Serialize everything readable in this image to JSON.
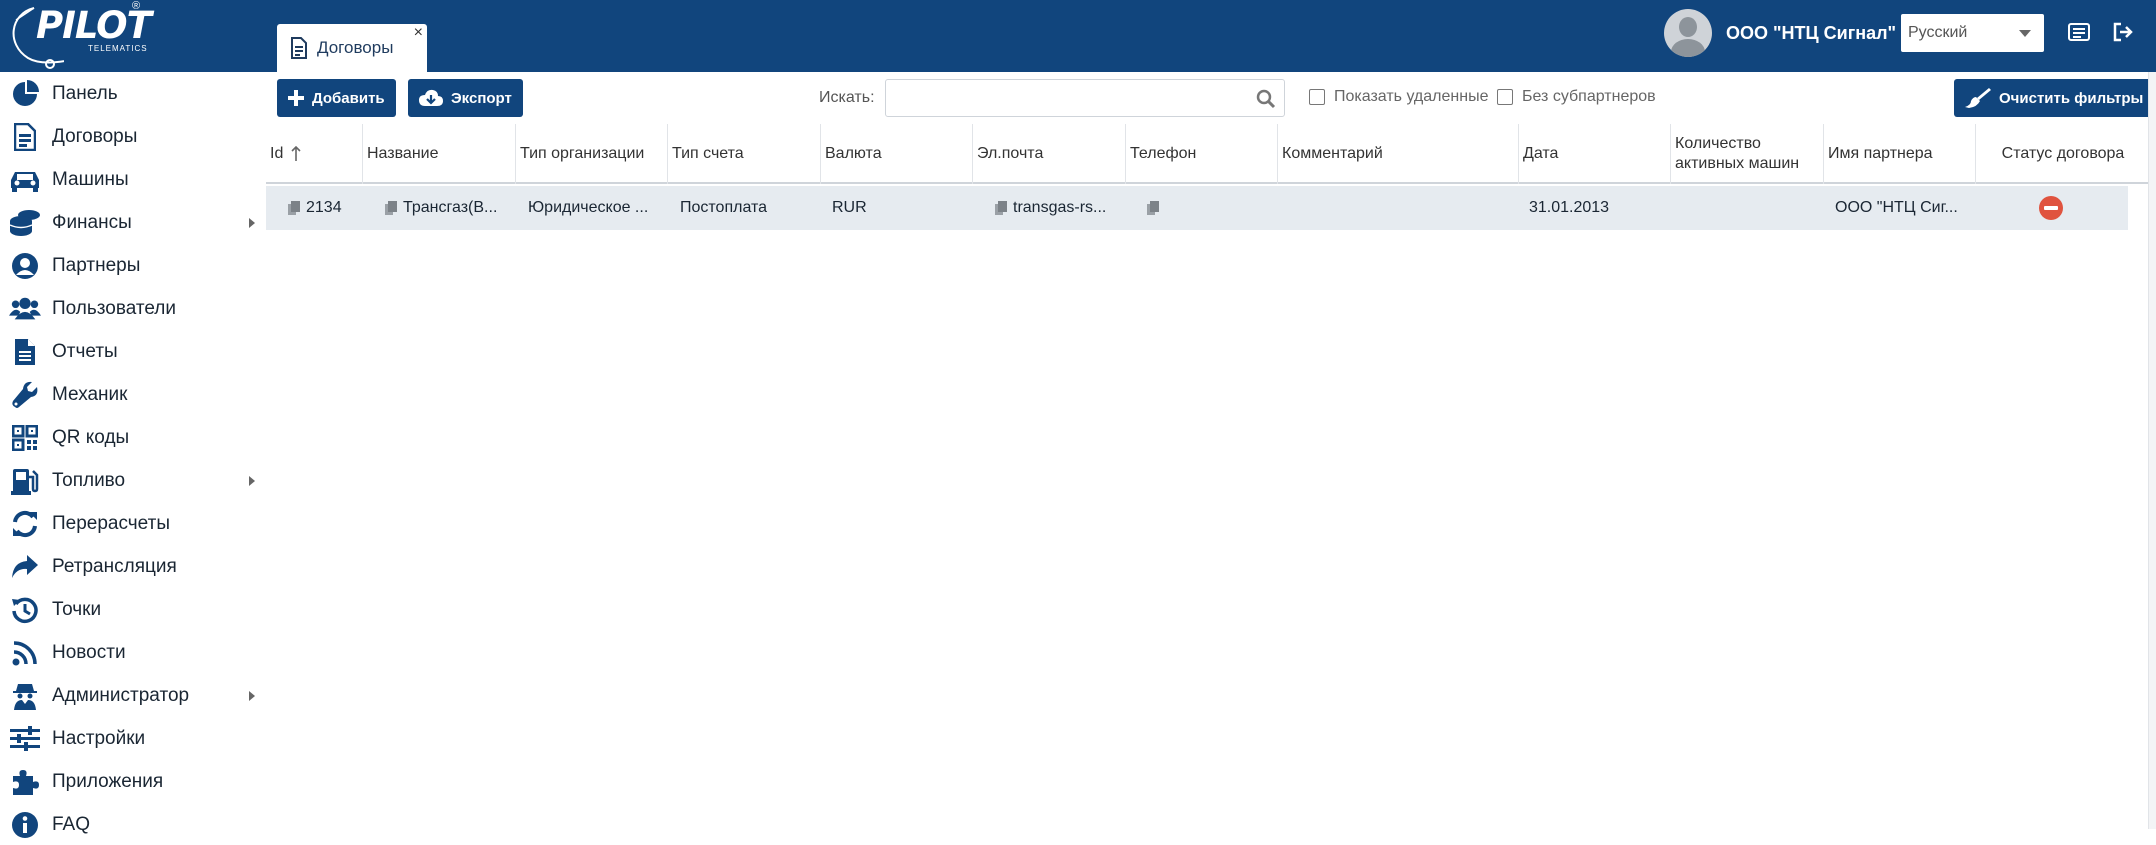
{
  "app": {
    "logo_text": "PILOT",
    "logo_sub": "TELEMATICS",
    "tab_label": "Договоры",
    "tab_close": "×",
    "user_name": "ООО \"НТЦ Сигнал\"",
    "language": "Русский",
    "brand_color": "#11457d"
  },
  "sidebar": {
    "items": [
      {
        "label": "Панель",
        "icon": "pie-chart-icon",
        "submenu": false
      },
      {
        "label": "Договоры",
        "icon": "contract-document-icon",
        "submenu": false
      },
      {
        "label": "Машины",
        "icon": "car-icon",
        "submenu": false
      },
      {
        "label": "Финансы",
        "icon": "coins-icon",
        "submenu": true
      },
      {
        "label": "Партнеры",
        "icon": "user-circle-icon",
        "submenu": false
      },
      {
        "label": "Пользователи",
        "icon": "users-icon",
        "submenu": false
      },
      {
        "label": "Отчеты",
        "icon": "report-file-icon",
        "submenu": false
      },
      {
        "label": "Механик",
        "icon": "wrench-icon",
        "submenu": false
      },
      {
        "label": "QR коды",
        "icon": "qr-code-icon",
        "submenu": false
      },
      {
        "label": "Топливо",
        "icon": "gas-pump-icon",
        "submenu": true
      },
      {
        "label": "Перерасчеты",
        "icon": "refresh-icon",
        "submenu": false
      },
      {
        "label": "Ретрансляция",
        "icon": "share-arrow-icon",
        "submenu": false
      },
      {
        "label": "Точки",
        "icon": "history-icon",
        "submenu": false
      },
      {
        "label": "Новости",
        "icon": "rss-icon",
        "submenu": false
      },
      {
        "label": "Администратор",
        "icon": "user-secret-icon",
        "submenu": true
      },
      {
        "label": "Настройки",
        "icon": "sliders-icon",
        "submenu": false
      },
      {
        "label": "Приложения",
        "icon": "puzzle-icon",
        "submenu": false
      },
      {
        "label": "FAQ",
        "icon": "info-circle-icon",
        "submenu": false
      }
    ]
  },
  "toolbar": {
    "add_label": "Добавить",
    "export_label": "Экспорт",
    "search_label": "Искать:",
    "search_value": "",
    "show_deleted_label": "Показать удаленные",
    "no_subpartners_label": "Без субпартнеров",
    "clear_filters_label": "Очистить фильтры"
  },
  "table": {
    "columns": [
      "Id",
      "Название",
      "Тип организации",
      "Тип счета",
      "Валюта",
      "Эл.почта",
      "Телефон",
      "Комментарий",
      "Дата",
      "Количество активных машин",
      "Имя партнера",
      "Статус договора"
    ],
    "rows": [
      {
        "id": "2134",
        "name": "Трансгаз(В...",
        "org_type": "Юридическое ...",
        "account_type": "Постоплата",
        "currency": "RUR",
        "email": "transgas-rs...",
        "phone": "",
        "comment": "",
        "date": "31.01.2013",
        "active_cars": "",
        "partner": "ООО \"НТЦ Сиг...",
        "status": "blocked",
        "status_color": "#e0533f"
      }
    ]
  }
}
